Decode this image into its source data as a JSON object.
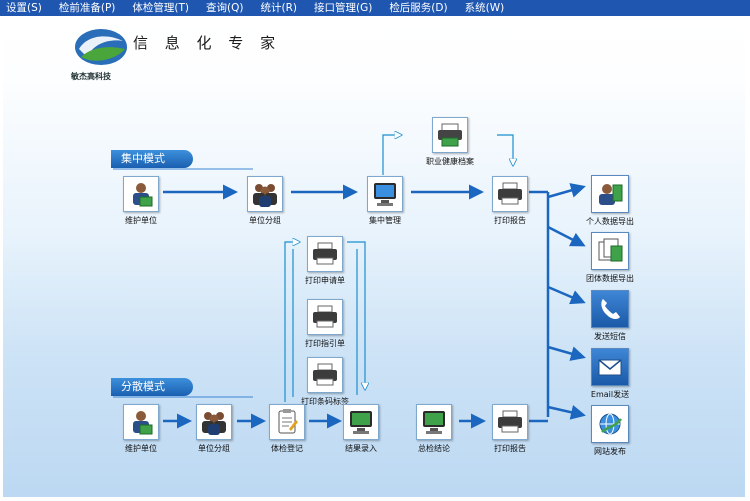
{
  "menu": [
    {
      "id": "settings",
      "label": "设置(S)"
    },
    {
      "id": "pre-check",
      "label": "检前准备(P)"
    },
    {
      "id": "exam-manage",
      "label": "体检管理(T)"
    },
    {
      "id": "query",
      "label": "查询(Q)"
    },
    {
      "id": "stats",
      "label": "统计(R)"
    },
    {
      "id": "interface",
      "label": "接口管理(G)"
    },
    {
      "id": "post-service",
      "label": "检后服务(D)"
    },
    {
      "id": "system",
      "label": "系统(W)"
    }
  ],
  "header": {
    "title": "信 息 化 专 家",
    "company": "敏杰高科技"
  },
  "modes": {
    "central": "集中模式",
    "distributed": "分散模式"
  },
  "nodes": {
    "central_maintain_unit": "维护单位",
    "central_unit_group": "单位分组",
    "central_manage": "集中管理",
    "health_archive": "职业健康档案",
    "print_report_top": "打印报告",
    "print_request": "打印申请单",
    "print_guide": "打印指引单",
    "print_barcode": "打印条码标签",
    "dist_maintain_unit": "维护单位",
    "dist_unit_group": "单位分组",
    "exam_register": "体检登记",
    "result_entry": "结果录入",
    "summary": "总检结论",
    "print_report_bottom": "打印报告"
  },
  "outputs": {
    "personal_export": "个人数据导出",
    "group_export": "团体数据导出",
    "send_sms": "发送短信",
    "email_send": "Email发送",
    "web_publish": "网站发布"
  },
  "colors": {
    "menubar": "#1e56b0",
    "accent": "#1a6fc8",
    "arrow": "#1b67c0"
  }
}
